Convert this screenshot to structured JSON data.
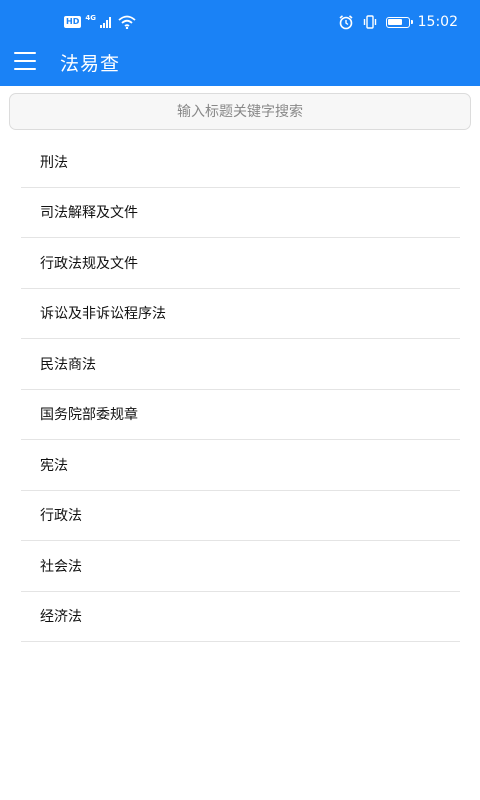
{
  "status_bar": {
    "hd_badge": "HD",
    "network": "4G",
    "time": "15:02",
    "battery_level": 0.75
  },
  "app_bar": {
    "title": "法易查",
    "menu_icon": "menu-icon"
  },
  "search": {
    "placeholder": "输入标题关键字搜索"
  },
  "categories": [
    "刑法",
    "司法解释及文件",
    "行政法规及文件",
    "诉讼及非诉讼程序法",
    "民法商法",
    "国务院部委规章",
    "宪法",
    "行政法",
    "社会法",
    "经济法"
  ],
  "colors": {
    "primary": "#1a82f6",
    "divider": "#e4e4e4"
  }
}
